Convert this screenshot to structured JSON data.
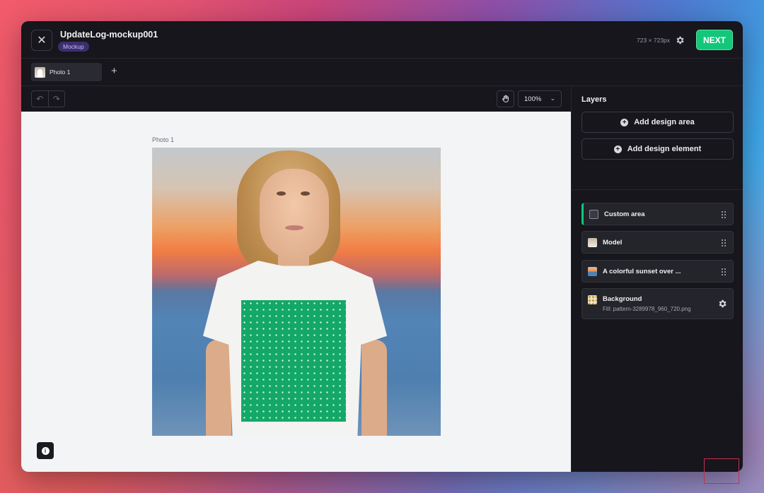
{
  "header": {
    "title": "UpdateLog-mockup001",
    "badge": "Mockup",
    "dimensions": "723 × 723px",
    "next_label": "NEXT",
    "accent_color": "#12c77a"
  },
  "tabs": {
    "items": [
      {
        "label": "Photo 1"
      }
    ],
    "add_label": "+"
  },
  "toolbar": {
    "zoom": "100%"
  },
  "canvas": {
    "photo_caption": "Photo 1",
    "design_area_color": "#14a868"
  },
  "layers": {
    "title": "Layers",
    "add_area_label": "Add design area",
    "add_element_label": "Add design element",
    "items": [
      {
        "label": "Custom area",
        "active": true
      },
      {
        "label": "Model"
      },
      {
        "label": "A colorful sunset over ..."
      },
      {
        "label": "Background",
        "sub": "Fill: pattern-3289978_960_720.png"
      }
    ]
  }
}
